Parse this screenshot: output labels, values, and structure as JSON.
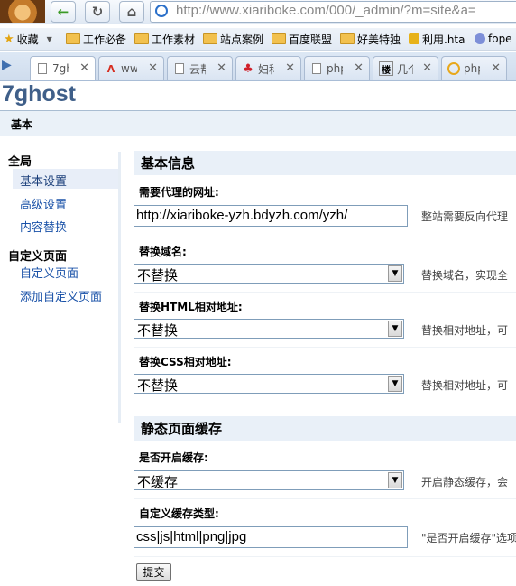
{
  "browser": {
    "url": "http://www.xiariboke.com/000/_admin/?m=site&a=",
    "bookmarks": [
      {
        "label": "收藏",
        "icon": "star-icon"
      },
      {
        "label": "工作必备",
        "icon": "folder-icon"
      },
      {
        "label": "工作素材",
        "icon": "folder-icon"
      },
      {
        "label": "站点案例",
        "icon": "folder-icon"
      },
      {
        "label": "百度联盟",
        "icon": "folder-icon"
      },
      {
        "label": "好美特独",
        "icon": "folder-icon"
      },
      {
        "label": "利用.hta",
        "icon": "trophy-icon"
      },
      {
        "label": "fope",
        "icon": "globe-icon"
      }
    ],
    "tabs": [
      {
        "label": "7gh",
        "icon": "page-icon"
      },
      {
        "label": "ww",
        "icon": "adobe-icon"
      },
      {
        "label": "云帮",
        "icon": "page-icon"
      },
      {
        "label": "妇科",
        "icon": "food-icon"
      },
      {
        "label": "php",
        "icon": "page-icon"
      },
      {
        "label": "几个",
        "icon": "char-icon"
      },
      {
        "label": "php",
        "icon": "ring-icon"
      }
    ]
  },
  "brand": "7ghost",
  "nav_tab": "基本",
  "sidebar": {
    "group1": "全局",
    "items1": [
      "基本设置",
      "高级设置",
      "内容替换"
    ],
    "group2": "自定义页面",
    "items2": [
      "自定义页面",
      "添加自定义页面"
    ]
  },
  "sections": {
    "basic": "基本信息",
    "cache": "静态页面缓存"
  },
  "fields": {
    "proxy_url": {
      "label": "需要代理的网址:",
      "value": "http://xiariboke-yzh.bdyzh.com/yzh/",
      "hint": "整站需要反向代理"
    },
    "replace_domain": {
      "label": "替换域名:",
      "value": "不替换",
      "hint": "替换域名，实现全"
    },
    "replace_html": {
      "label": "替换HTML相对地址:",
      "value": "不替换",
      "hint": "替换相对地址，可"
    },
    "replace_css": {
      "label": "替换CSS相对地址:",
      "value": "不替换",
      "hint": "替换相对地址，可"
    },
    "cache_enabled": {
      "label": "是否开启缓存:",
      "value": "不缓存",
      "hint": "开启静态缓存，会"
    },
    "cache_types": {
      "label": "自定义缓存类型:",
      "value": "css|js|html|png|jpg",
      "hint": "\"是否开启缓存\"选项"
    }
  },
  "submit_label": "提交"
}
